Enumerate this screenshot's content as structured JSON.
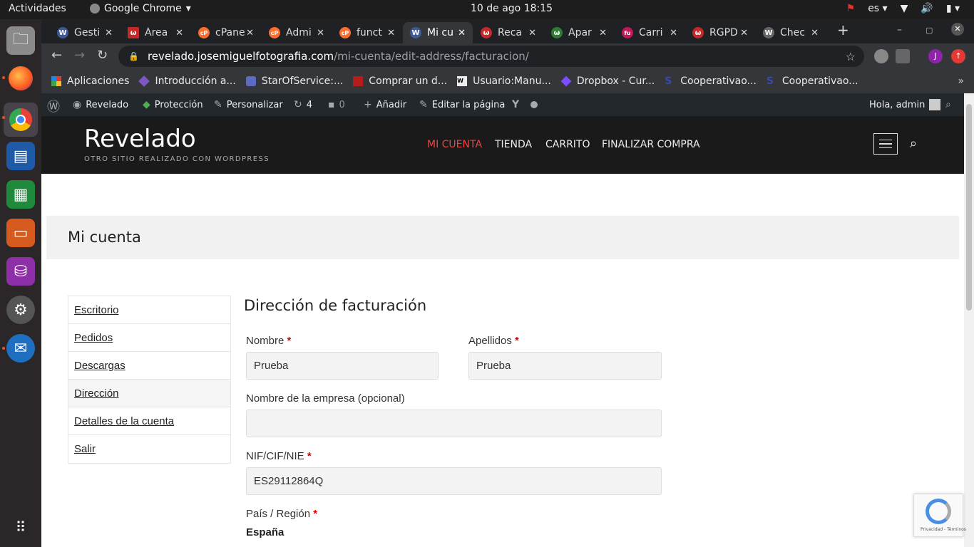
{
  "os": {
    "activities": "Actividades",
    "app_name": "Google Chrome",
    "clock": "10 de ago  18:15",
    "lang": "es"
  },
  "tabs": [
    {
      "title": "Gesti",
      "color": "#3c5a9a",
      "glyph": "W"
    },
    {
      "title": "Área",
      "color": "#c62828",
      "glyph": "ω"
    },
    {
      "title": "cPane",
      "color": "#ff6c2c",
      "glyph": "cP"
    },
    {
      "title": "Admi",
      "color": "#ff6c2c",
      "glyph": "cP"
    },
    {
      "title": "funct",
      "color": "#ff6c2c",
      "glyph": "cP"
    },
    {
      "title": "Mi cu",
      "color": "#3c5a9a",
      "glyph": "W"
    },
    {
      "title": "Reca",
      "color": "#c62828",
      "glyph": "ω"
    },
    {
      "title": "Apar",
      "color": "#2e7d32",
      "glyph": "ω"
    },
    {
      "title": "Carri",
      "color": "#c2185b",
      "glyph": "fu"
    },
    {
      "title": "RGPD",
      "color": "#c62828",
      "glyph": "ω"
    },
    {
      "title": "Chec",
      "color": "#666666",
      "glyph": "W"
    }
  ],
  "url": {
    "domain": "revelado.josemiguelfotografia.com",
    "path": "/mi-cuenta/edit-address/facturacion/"
  },
  "bookmarks": [
    {
      "label": "Aplicaciones",
      "color": "#e53935"
    },
    {
      "label": "Introducción a...",
      "color": "#7e57c2"
    },
    {
      "label": "StarOfService:...",
      "color": "#5c6bc0"
    },
    {
      "label": "Comprar un d...",
      "color": "#b71c1c"
    },
    {
      "label": "Usuario:Manu...",
      "color": "#eeeeee"
    },
    {
      "label": "Dropbox - Cur...",
      "color": "#7c4dff"
    },
    {
      "label": "Cooperativao...",
      "color": "#3949ab"
    },
    {
      "label": "Cooperativao...",
      "color": "#3949ab"
    }
  ],
  "adminbar": {
    "site": "Revelado",
    "protection": "Protección",
    "customize": "Personalizar",
    "updates": "4",
    "comments": "0",
    "add": "Añadir",
    "edit": "Editar la página",
    "greeting": "Hola, admin"
  },
  "site": {
    "title": "Revelado",
    "tagline": "OTRO SITIO REALIZADO CON WORDPRESS",
    "nav": [
      "MI CUENTA",
      "TIENDA",
      "CARRITO",
      "FINALIZAR COMPRA"
    ],
    "accent": "#e44444"
  },
  "page": {
    "title": "Mi cuenta",
    "account_nav": [
      "Escritorio",
      "Pedidos",
      "Descargas",
      "Dirección",
      "Detalles de la cuenta",
      "Salir"
    ],
    "active_nav": "Dirección"
  },
  "form": {
    "heading": "Dirección de facturación",
    "first_name_label": "Nombre",
    "first_name_value": "Prueba",
    "last_name_label": "Apellidos",
    "last_name_value": "Prueba",
    "company_label": "Nombre de la empresa (opcional)",
    "company_value": "",
    "nif_label": "NIF/CIF/NIE",
    "nif_value": "ES29112864Q",
    "country_label": "País / Región",
    "country_value": "España",
    "required_mark": "*"
  },
  "recaptcha": {
    "footer": "Privacidad - Términos"
  }
}
